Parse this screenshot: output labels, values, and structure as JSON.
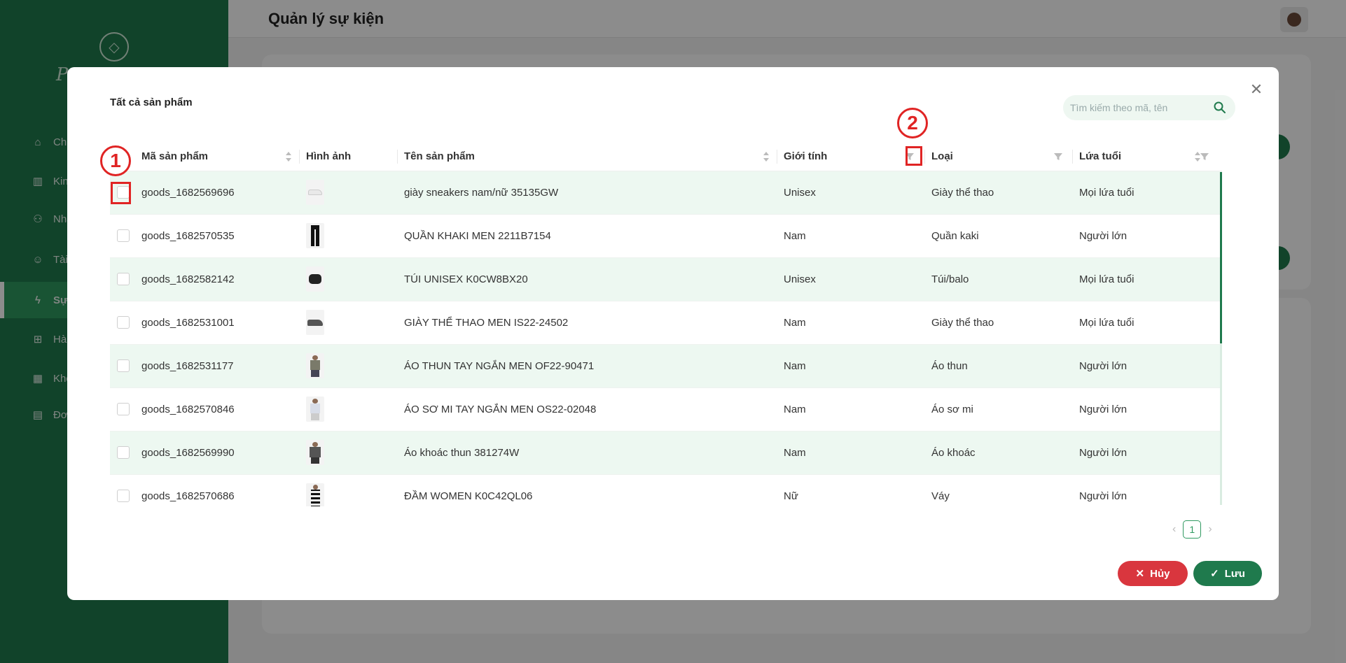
{
  "app": {
    "page_title": "Quản lý sự kiện",
    "brand_text": "P",
    "sidebar_items": [
      {
        "icon": "home-icon",
        "label": "Chi"
      },
      {
        "icon": "chart-icon",
        "label": "Kin"
      },
      {
        "icon": "users-icon",
        "label": "Nhâ"
      },
      {
        "icon": "user-icon",
        "label": "Tài"
      },
      {
        "icon": "bolt-icon",
        "label": "Sự"
      },
      {
        "icon": "grid-icon",
        "label": "Hàn"
      },
      {
        "icon": "building-icon",
        "label": "Kho"
      },
      {
        "icon": "clipboard-icon",
        "label": "Đơn"
      }
    ],
    "active_item_index": 4
  },
  "modal": {
    "title": "Tất cả sản phẩm",
    "search_placeholder": "Tìm kiếm theo mã, tên",
    "columns": [
      "Mã sản phẩm",
      "Hình ảnh",
      "Tên sản phẩm",
      "Giới tính",
      "Loại",
      "Lứa tuổi"
    ],
    "rows": [
      {
        "code": "goods_1682569696",
        "image": "white-sneaker",
        "name": "giày sneakers nam/nữ 35135GW",
        "gender": "Unisex",
        "type": "Giày thể thao",
        "age": "Mọi lứa tuổi"
      },
      {
        "code": "goods_1682570535",
        "image": "black-pants",
        "name": "QUẦN KHAKI MEN 2211B7154",
        "gender": "Nam",
        "type": "Quần kaki",
        "age": "Người lớn"
      },
      {
        "code": "goods_1682582142",
        "image": "black-bag",
        "name": "TÚI UNISEX K0CW8BX20",
        "gender": "Unisex",
        "type": "Túi/balo",
        "age": "Mọi lứa tuổi"
      },
      {
        "code": "goods_1682531001",
        "image": "grey-shoe",
        "name": "GIÀY THỂ THAO MEN IS22-24502",
        "gender": "Nam",
        "type": "Giày thể thao",
        "age": "Mọi lứa tuổi"
      },
      {
        "code": "goods_1682531177",
        "image": "tshirt-model",
        "name": "ÁO THUN TAY NGẮN MEN OF22-90471",
        "gender": "Nam",
        "type": "Áo thun",
        "age": "Người lớn"
      },
      {
        "code": "goods_1682570846",
        "image": "shirt-model",
        "name": "ÁO SƠ MI TAY NGẮN MEN OS22-02048",
        "gender": "Nam",
        "type": "Áo sơ mi",
        "age": "Người lớn"
      },
      {
        "code": "goods_1682569990",
        "image": "jacket-model",
        "name": "Áo khoác thun 381274W",
        "gender": "Nam",
        "type": "Áo khoác",
        "age": "Người lớn"
      },
      {
        "code": "goods_1682570686",
        "image": "dress-model",
        "name": "ĐẦM WOMEN K0C42QL06",
        "gender": "Nữ",
        "type": "Váy",
        "age": "Người lớn"
      }
    ],
    "pagination": {
      "current": "1",
      "prev": "‹",
      "next": "›"
    },
    "buttons": {
      "cancel": "Hủy",
      "save": "Lưu"
    },
    "annotations": [
      "1",
      "2"
    ],
    "colors": {
      "primary": "#1f7a4d",
      "danger": "#d9363e",
      "row_alt": "#edf8f1",
      "annotation": "#e02424"
    }
  }
}
